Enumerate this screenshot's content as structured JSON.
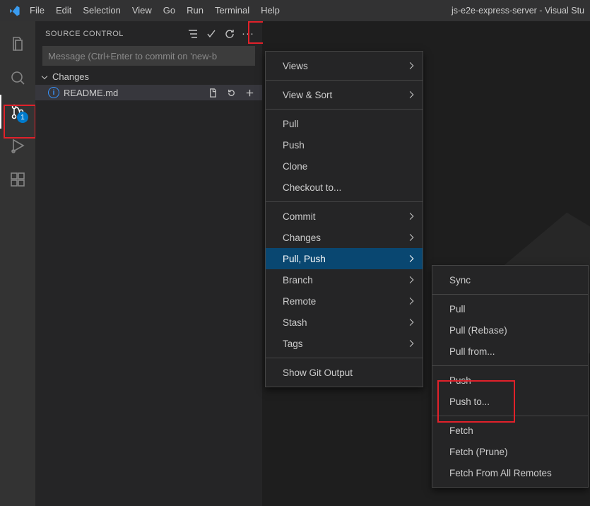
{
  "menubar": {
    "file": "File",
    "edit": "Edit",
    "selection": "Selection",
    "view": "View",
    "go": "Go",
    "run": "Run",
    "terminal": "Terminal",
    "help": "Help"
  },
  "window_title": "js-e2e-express-server - Visual Stu",
  "activitybar": {
    "scm_badge": "1"
  },
  "panel": {
    "title": "SOURCE CONTROL",
    "commit_placeholder": "Message (Ctrl+Enter to commit on 'new-b",
    "changes_label": "Changes",
    "file": "README.md"
  },
  "ctxmenu1": {
    "views": "Views",
    "view_sort": "View & Sort",
    "pull": "Pull",
    "push": "Push",
    "clone": "Clone",
    "checkout": "Checkout to...",
    "commit": "Commit",
    "changes": "Changes",
    "pull_push": "Pull, Push",
    "branch": "Branch",
    "remote": "Remote",
    "stash": "Stash",
    "tags": "Tags",
    "show_git_output": "Show Git Output"
  },
  "ctxmenu2": {
    "sync": "Sync",
    "pull": "Pull",
    "pull_rebase": "Pull (Rebase)",
    "pull_from": "Pull from...",
    "push": "Push",
    "push_to": "Push to...",
    "fetch": "Fetch",
    "fetch_prune": "Fetch (Prune)",
    "fetch_all": "Fetch From All Remotes"
  }
}
